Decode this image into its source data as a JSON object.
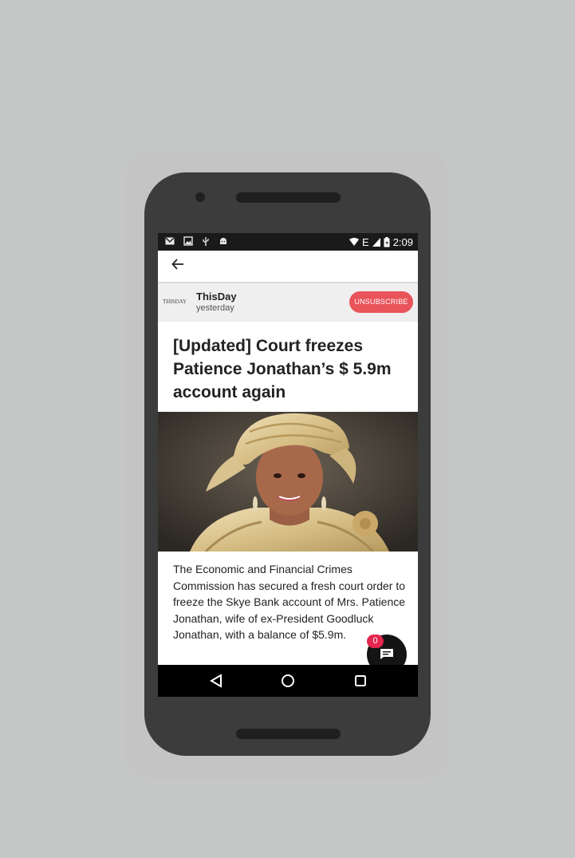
{
  "status_bar": {
    "time": "2:09",
    "network": "E",
    "icons": [
      "gmail-icon",
      "image-icon",
      "usb-icon",
      "android-debug-icon",
      "wifi-icon",
      "signal-icon",
      "battery-icon"
    ]
  },
  "app_bar": {
    "back_icon": "arrow-left-icon"
  },
  "source": {
    "logo_text": "THISDAY",
    "name": "ThisDay",
    "time": "yesterday",
    "unsubscribe_label": "UNSUBSCRIBE"
  },
  "article": {
    "title": "[Updated] Court freezes Patience Jonathan’s $ 5.9m account again",
    "body": "The Economic and Financial Crimes Commission has secured a fresh court order to freeze the Skye Bank account of Mrs. Patience Jonathan, wife of ex-President Goodluck Jonathan, with a balance of $5.9m."
  },
  "comments_fab": {
    "icon": "comment-icon",
    "count": "0"
  },
  "nav_bar": {
    "icons": [
      "back-triangle-icon",
      "home-circle-icon",
      "recents-square-icon"
    ]
  },
  "colors": {
    "accent": "#e9535a",
    "badge": "#e2264d",
    "background": "#c5c7c6",
    "phone_body": "#3c3c3c"
  }
}
